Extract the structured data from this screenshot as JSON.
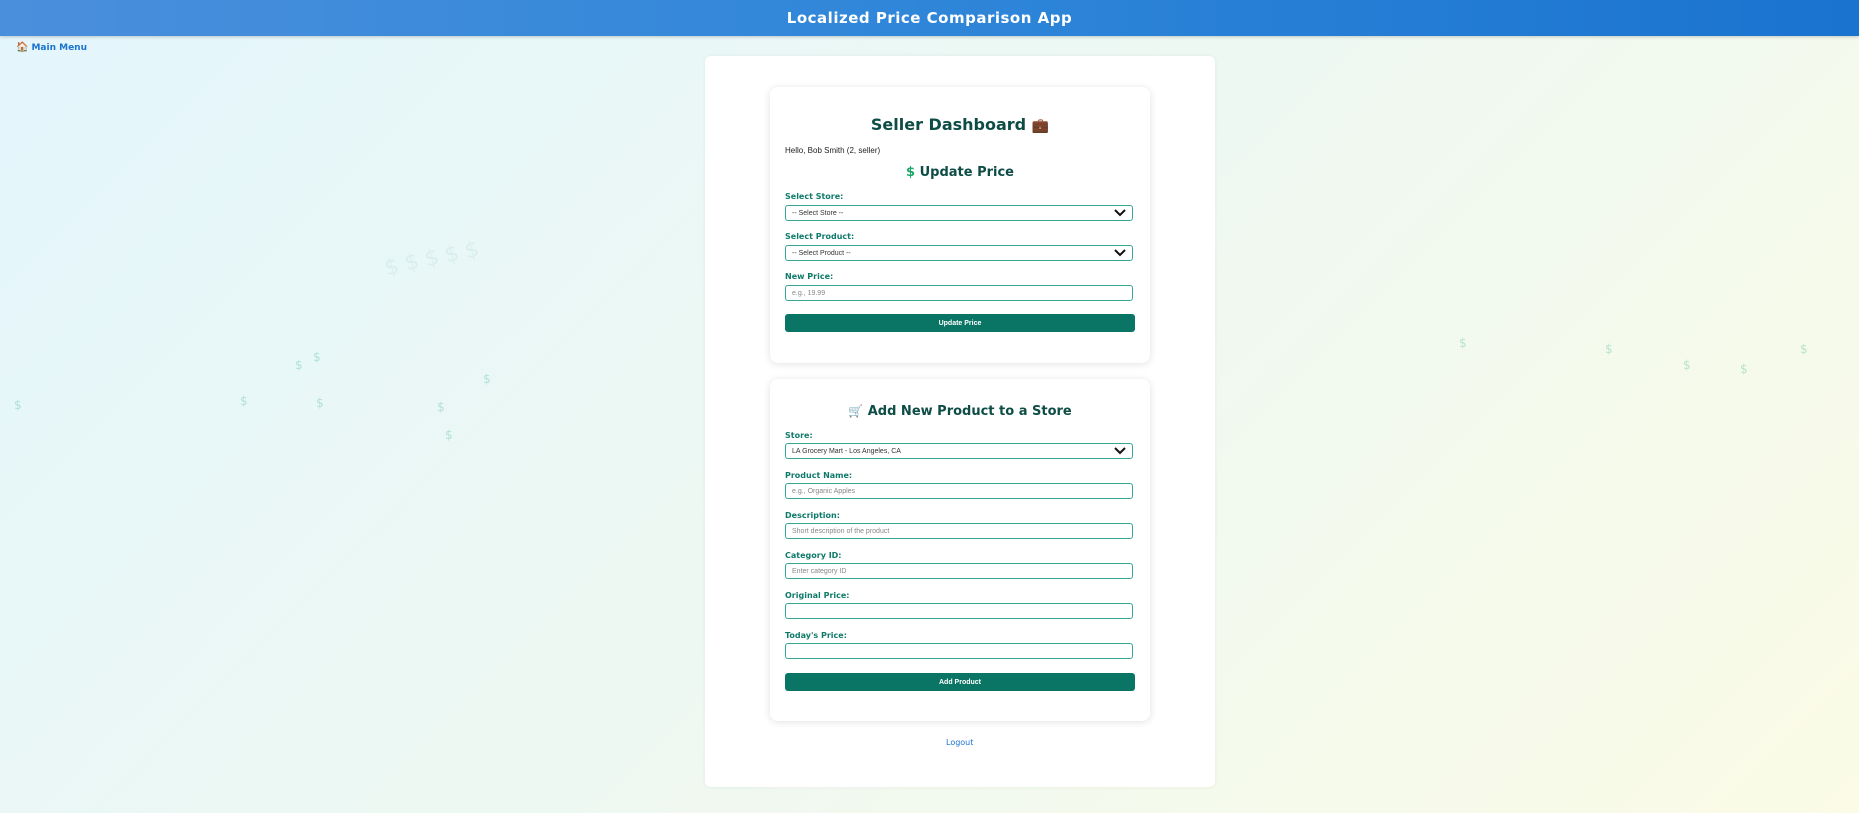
{
  "header": {
    "title": "Localized Price Comparison App"
  },
  "nav": {
    "main_menu_label": "Main Menu",
    "main_menu_icon": "house-icon"
  },
  "dashboard": {
    "title": "Seller Dashboard",
    "title_icon": "briefcase-icon",
    "greeting": "Hello, Bob Smith (2, seller)"
  },
  "update_price": {
    "heading": "Update Price",
    "heading_icon": "dollar-icon",
    "store_label": "Select Store:",
    "store_value": "-- Select Store --",
    "product_label": "Select Product:",
    "product_value": "-- Select Product --",
    "price_label": "New Price:",
    "price_placeholder": "e.g., 19.99",
    "submit_label": "Update Price"
  },
  "add_product": {
    "heading": "Add New Product to a Store",
    "heading_icon": "cart-icon",
    "store_label": "Store:",
    "store_value": "LA Grocery Mart - Los Angeles, CA",
    "name_label": "Product Name:",
    "name_placeholder": "e.g., Organic Apples",
    "description_label": "Description:",
    "description_placeholder": "Short description of the product",
    "category_label": "Category ID:",
    "category_placeholder": "Enter category ID",
    "original_price_label": "Original Price:",
    "original_price_value": "",
    "todays_price_label": "Today's Price:",
    "todays_price_value": "",
    "submit_label": "Add Product"
  },
  "footer": {
    "logout_label": "Logout"
  },
  "colors": {
    "header_blue": "#1a73cf",
    "accent_teal": "#0a7565",
    "label_teal": "#0f7a6a",
    "heading_dark": "#0d4d45"
  }
}
